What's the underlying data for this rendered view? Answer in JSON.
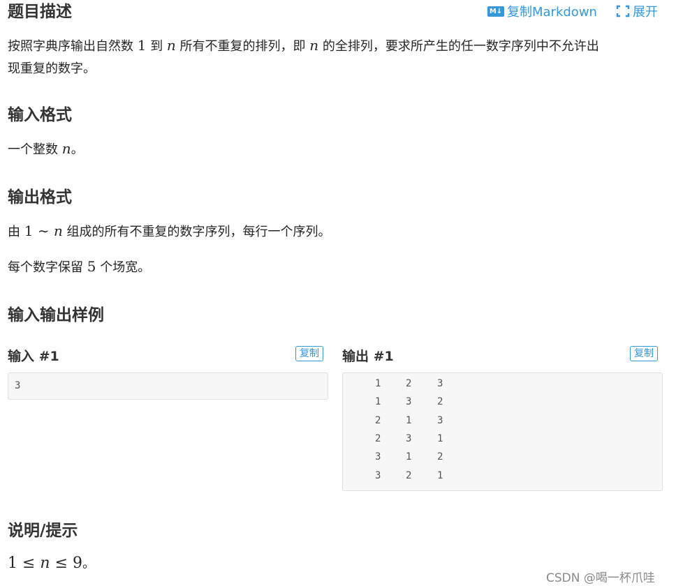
{
  "header": {
    "title": "题目描述",
    "copy_markdown_icon": "MD-icon",
    "copy_markdown_icon_text": "M↓",
    "copy_markdown_label": "复制Markdown",
    "expand_icon": "expand-icon",
    "expand_label": "展开"
  },
  "description": {
    "line1_part1": "按照字典序输出自然数 ",
    "line1_num": "1",
    "line1_part2": " 到 ",
    "line1_var": "n",
    "line1_part3": " 所有不重复的排列，即 ",
    "line1_var2": "n",
    "line1_part4": " 的全排列，要求所产生的任一数字序列中不允许出",
    "line2": "现重复的数字。"
  },
  "input_format": {
    "heading": "输入格式",
    "text_part1": "一个整数 ",
    "text_var": "n",
    "text_part2": "。"
  },
  "output_format": {
    "heading": "输出格式",
    "line1_part1": "由 ",
    "line1_math": "1 ∼ ",
    "line1_var": "n",
    "line1_part2": " 组成的所有不重复的数字序列，每行一个序列。",
    "line2_part1": "每个数字保留 ",
    "line2_num": "5",
    "line2_part2": " 个场宽。"
  },
  "samples": {
    "heading": "输入输出样例",
    "input_title": "输入 #1",
    "output_title": "输出 #1",
    "copy_label": "复制",
    "input_value": "3",
    "output_rows": [
      [
        "1",
        "2",
        "3"
      ],
      [
        "1",
        "3",
        "2"
      ],
      [
        "2",
        "1",
        "3"
      ],
      [
        "2",
        "3",
        "1"
      ],
      [
        "3",
        "1",
        "2"
      ],
      [
        "3",
        "2",
        "1"
      ]
    ]
  },
  "hint": {
    "heading": "说明/提示",
    "math_part1": "1 ≤ ",
    "math_var": "n",
    "math_part2": " ≤ 9",
    "tail": "。"
  },
  "watermark": "CSDN @喝一杯爪哇",
  "colors": {
    "accent": "#3498db",
    "code_bg": "#f7f7f7"
  }
}
